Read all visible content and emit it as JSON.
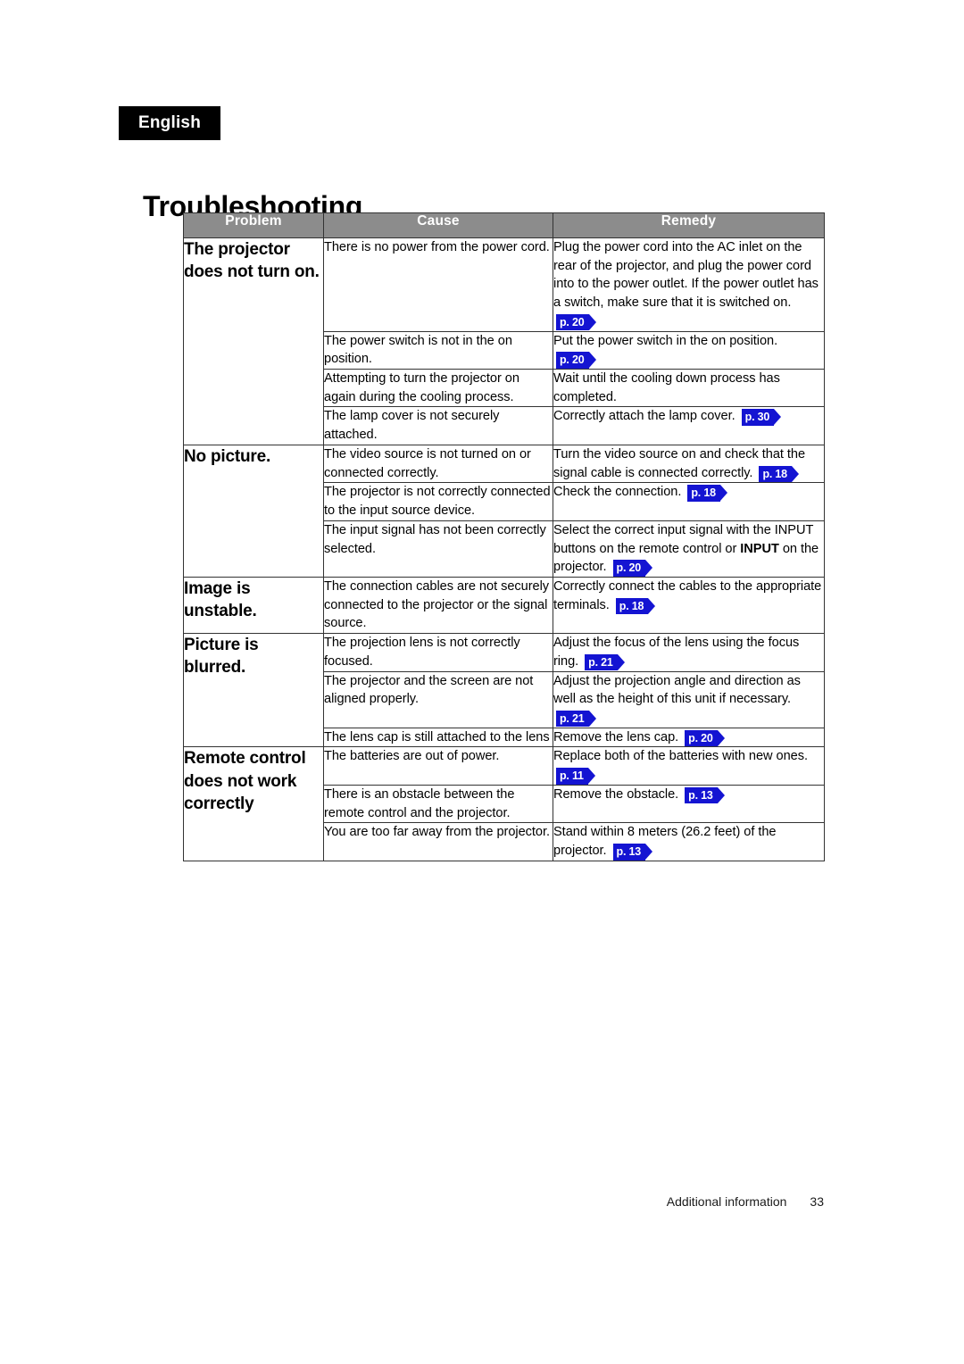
{
  "header": {
    "language_tag": "English",
    "title": "Troubleshooting"
  },
  "table": {
    "columns": [
      "Problem",
      "Cause",
      "Remedy"
    ],
    "groups": [
      {
        "problem": "The projector does not turn on.",
        "rows": [
          {
            "cause": "There is no power from the power cord.",
            "remedy_text": "Plug the power cord into the AC inlet on the rear of the projector, and plug the power cord into to the power outlet. If the power outlet has a switch, make sure that it is switched on.",
            "remedy_ref": "p. 20"
          },
          {
            "cause": "The power switch is not in the on position.",
            "remedy_text": "Put the power switch in the on position.",
            "remedy_ref": "p. 20"
          },
          {
            "cause": "Attempting to turn the projector on again during the cooling process.",
            "remedy_text": "Wait until the cooling down process has completed.",
            "remedy_ref": ""
          },
          {
            "cause": "The lamp cover is not securely attached.",
            "remedy_text": "Correctly attach the lamp cover.",
            "remedy_ref": "p. 30"
          }
        ]
      },
      {
        "problem": "No picture.",
        "rows": [
          {
            "cause": "The video source is not turned on or connected correctly.",
            "remedy_text": "Turn the video source on and check that the signal cable is connected correctly.",
            "remedy_ref": "p. 18"
          },
          {
            "cause": "The projector is not correctly connected to the input source device.",
            "remedy_text": "Check the connection.",
            "remedy_ref": "p. 18"
          },
          {
            "cause": "The input signal has not been correctly selected.",
            "remedy_text_a": "Select the correct input signal with the INPUT buttons on the remote control or ",
            "remedy_bold": "INPUT",
            "remedy_text_b": " on the projector.",
            "remedy_ref": "p. 20"
          }
        ]
      },
      {
        "problem": "Image is unstable.",
        "rows": [
          {
            "cause": "The connection cables are not securely connected to the projector or the signal source.",
            "remedy_text": "Correctly connect the cables to the appropriate terminals.",
            "remedy_ref": "p. 18"
          }
        ]
      },
      {
        "problem": "Picture is blurred.",
        "rows": [
          {
            "cause": "The projection lens is not correctly focused.",
            "remedy_text": "Adjust the focus of the lens using the focus ring.",
            "remedy_ref": "p. 21"
          },
          {
            "cause": "The projector and the screen are not aligned properly.",
            "remedy_text": "Adjust the projection angle and direction as well as the height of this unit if necessary.",
            "remedy_ref": "p. 21"
          },
          {
            "cause": "The lens cap is still attached to the lens",
            "remedy_text": "Remove the lens cap.",
            "remedy_ref": "p. 20"
          }
        ]
      },
      {
        "problem": "Remote control does not work correctly",
        "rows": [
          {
            "cause": "The batteries are out of power.",
            "remedy_text": "Replace both of the batteries with new ones.",
            "remedy_ref": "p. 11"
          },
          {
            "cause": "There is an obstacle between the remote control and the projector.",
            "remedy_text": "Remove the obstacle.",
            "remedy_ref": "p. 13"
          },
          {
            "cause": "You are too far away from the projector.",
            "remedy_text": "Stand within 8 meters (26.2 feet) of the projector.",
            "remedy_ref": "p. 13"
          }
        ]
      }
    ]
  },
  "footer": {
    "section": "Additional information",
    "page_number": "33"
  },
  "colors": {
    "header_row_bg": "#8c8c8c",
    "reference_badge": "#1414d2",
    "tag_bg": "#000000"
  }
}
